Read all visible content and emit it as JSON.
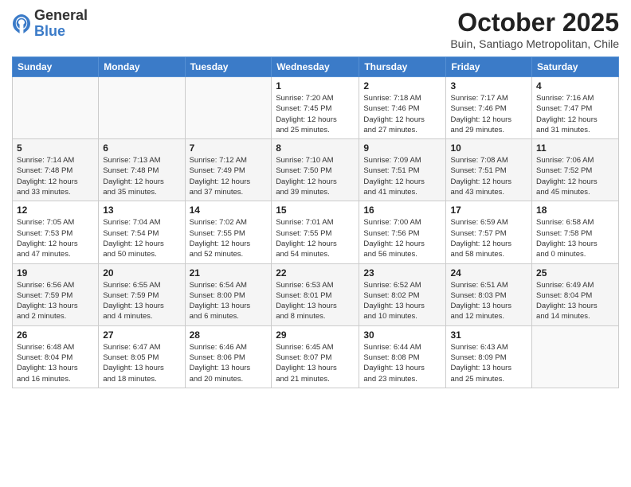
{
  "logo": {
    "general": "General",
    "blue": "Blue"
  },
  "header": {
    "month": "October 2025",
    "location": "Buin, Santiago Metropolitan, Chile"
  },
  "weekdays": [
    "Sunday",
    "Monday",
    "Tuesday",
    "Wednesday",
    "Thursday",
    "Friday",
    "Saturday"
  ],
  "weeks": [
    [
      {
        "day": "",
        "info": ""
      },
      {
        "day": "",
        "info": ""
      },
      {
        "day": "",
        "info": ""
      },
      {
        "day": "1",
        "info": "Sunrise: 7:20 AM\nSunset: 7:45 PM\nDaylight: 12 hours\nand 25 minutes."
      },
      {
        "day": "2",
        "info": "Sunrise: 7:18 AM\nSunset: 7:46 PM\nDaylight: 12 hours\nand 27 minutes."
      },
      {
        "day": "3",
        "info": "Sunrise: 7:17 AM\nSunset: 7:46 PM\nDaylight: 12 hours\nand 29 minutes."
      },
      {
        "day": "4",
        "info": "Sunrise: 7:16 AM\nSunset: 7:47 PM\nDaylight: 12 hours\nand 31 minutes."
      }
    ],
    [
      {
        "day": "5",
        "info": "Sunrise: 7:14 AM\nSunset: 7:48 PM\nDaylight: 12 hours\nand 33 minutes."
      },
      {
        "day": "6",
        "info": "Sunrise: 7:13 AM\nSunset: 7:48 PM\nDaylight: 12 hours\nand 35 minutes."
      },
      {
        "day": "7",
        "info": "Sunrise: 7:12 AM\nSunset: 7:49 PM\nDaylight: 12 hours\nand 37 minutes."
      },
      {
        "day": "8",
        "info": "Sunrise: 7:10 AM\nSunset: 7:50 PM\nDaylight: 12 hours\nand 39 minutes."
      },
      {
        "day": "9",
        "info": "Sunrise: 7:09 AM\nSunset: 7:51 PM\nDaylight: 12 hours\nand 41 minutes."
      },
      {
        "day": "10",
        "info": "Sunrise: 7:08 AM\nSunset: 7:51 PM\nDaylight: 12 hours\nand 43 minutes."
      },
      {
        "day": "11",
        "info": "Sunrise: 7:06 AM\nSunset: 7:52 PM\nDaylight: 12 hours\nand 45 minutes."
      }
    ],
    [
      {
        "day": "12",
        "info": "Sunrise: 7:05 AM\nSunset: 7:53 PM\nDaylight: 12 hours\nand 47 minutes."
      },
      {
        "day": "13",
        "info": "Sunrise: 7:04 AM\nSunset: 7:54 PM\nDaylight: 12 hours\nand 50 minutes."
      },
      {
        "day": "14",
        "info": "Sunrise: 7:02 AM\nSunset: 7:55 PM\nDaylight: 12 hours\nand 52 minutes."
      },
      {
        "day": "15",
        "info": "Sunrise: 7:01 AM\nSunset: 7:55 PM\nDaylight: 12 hours\nand 54 minutes."
      },
      {
        "day": "16",
        "info": "Sunrise: 7:00 AM\nSunset: 7:56 PM\nDaylight: 12 hours\nand 56 minutes."
      },
      {
        "day": "17",
        "info": "Sunrise: 6:59 AM\nSunset: 7:57 PM\nDaylight: 12 hours\nand 58 minutes."
      },
      {
        "day": "18",
        "info": "Sunrise: 6:58 AM\nSunset: 7:58 PM\nDaylight: 13 hours\nand 0 minutes."
      }
    ],
    [
      {
        "day": "19",
        "info": "Sunrise: 6:56 AM\nSunset: 7:59 PM\nDaylight: 13 hours\nand 2 minutes."
      },
      {
        "day": "20",
        "info": "Sunrise: 6:55 AM\nSunset: 7:59 PM\nDaylight: 13 hours\nand 4 minutes."
      },
      {
        "day": "21",
        "info": "Sunrise: 6:54 AM\nSunset: 8:00 PM\nDaylight: 13 hours\nand 6 minutes."
      },
      {
        "day": "22",
        "info": "Sunrise: 6:53 AM\nSunset: 8:01 PM\nDaylight: 13 hours\nand 8 minutes."
      },
      {
        "day": "23",
        "info": "Sunrise: 6:52 AM\nSunset: 8:02 PM\nDaylight: 13 hours\nand 10 minutes."
      },
      {
        "day": "24",
        "info": "Sunrise: 6:51 AM\nSunset: 8:03 PM\nDaylight: 13 hours\nand 12 minutes."
      },
      {
        "day": "25",
        "info": "Sunrise: 6:49 AM\nSunset: 8:04 PM\nDaylight: 13 hours\nand 14 minutes."
      }
    ],
    [
      {
        "day": "26",
        "info": "Sunrise: 6:48 AM\nSunset: 8:04 PM\nDaylight: 13 hours\nand 16 minutes."
      },
      {
        "day": "27",
        "info": "Sunrise: 6:47 AM\nSunset: 8:05 PM\nDaylight: 13 hours\nand 18 minutes."
      },
      {
        "day": "28",
        "info": "Sunrise: 6:46 AM\nSunset: 8:06 PM\nDaylight: 13 hours\nand 20 minutes."
      },
      {
        "day": "29",
        "info": "Sunrise: 6:45 AM\nSunset: 8:07 PM\nDaylight: 13 hours\nand 21 minutes."
      },
      {
        "day": "30",
        "info": "Sunrise: 6:44 AM\nSunset: 8:08 PM\nDaylight: 13 hours\nand 23 minutes."
      },
      {
        "day": "31",
        "info": "Sunrise: 6:43 AM\nSunset: 8:09 PM\nDaylight: 13 hours\nand 25 minutes."
      },
      {
        "day": "",
        "info": ""
      }
    ]
  ]
}
